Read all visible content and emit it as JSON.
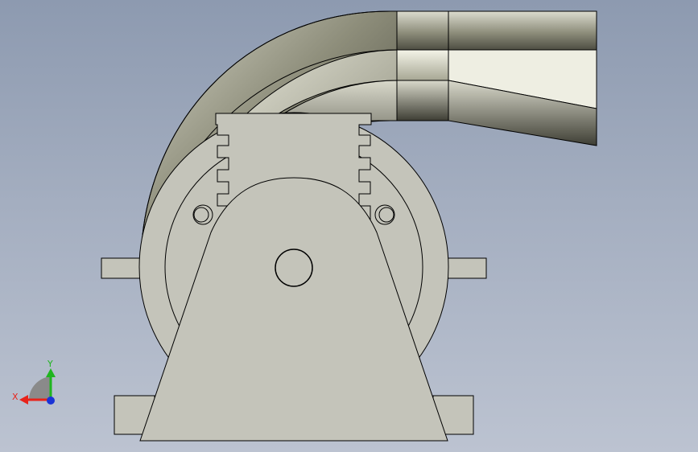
{
  "viewport": {
    "label": "3D model view",
    "view": "front"
  },
  "model": {
    "name": "",
    "parts": [
      "discharge-duct",
      "elbow-pipe",
      "fan-housing",
      "motor-mount-plate",
      "support-base",
      "shaft-hub",
      "mounting-lugs",
      "mounting-feet"
    ]
  },
  "triad": {
    "x_label": "X",
    "y_label": "Y",
    "x_color": "#e8231b",
    "y_color": "#1fb51f",
    "z_color": "#1a33d6"
  },
  "colors": {
    "background_top": "#8d9ab0",
    "background_bottom": "#bcc3d1",
    "body_fill": "#c4c4ba",
    "edge": "#000000",
    "duct_highlight": "#eeeee2"
  }
}
